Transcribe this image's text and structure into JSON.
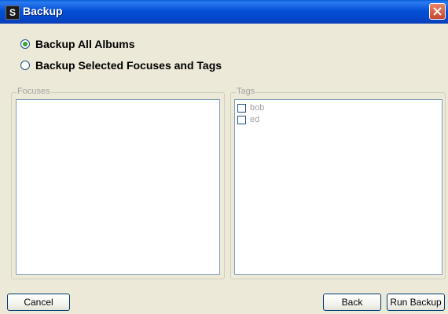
{
  "window": {
    "title": "Backup",
    "app_icon_letter": "S"
  },
  "options": {
    "backup_all": {
      "label": "Backup All Albums",
      "selected": true
    },
    "backup_selected": {
      "label": "Backup Selected Focuses and Tags",
      "selected": false
    }
  },
  "focuses": {
    "legend": "Focuses",
    "items": []
  },
  "tags": {
    "legend": "Tags",
    "items": [
      {
        "label": "bob",
        "checked": false
      },
      {
        "label": "ed",
        "checked": false
      }
    ]
  },
  "buttons": {
    "cancel": "Cancel",
    "back": "Back",
    "run_backup": "Run Backup"
  },
  "colors": {
    "titlebar": "#0550d6",
    "dialog_bg": "#ece9d8",
    "close_button": "#d0502f",
    "radio_selected": "#3ba035"
  }
}
